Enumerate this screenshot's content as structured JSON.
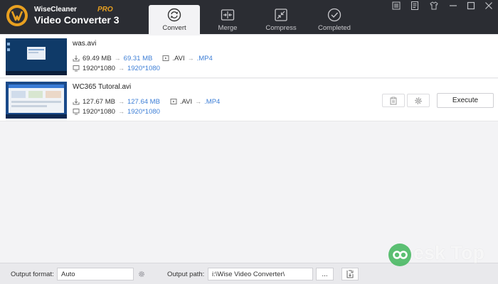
{
  "app": {
    "brand_top": "WiseCleaner",
    "brand_pro": "PRO",
    "brand_name": "Video Converter 3"
  },
  "tabs": [
    {
      "label": "Convert",
      "icon": "convert-icon",
      "active": true
    },
    {
      "label": "Merge",
      "icon": "merge-icon",
      "active": false
    },
    {
      "label": "Compress",
      "icon": "compress-icon",
      "active": false
    },
    {
      "label": "Completed",
      "icon": "completed-icon",
      "active": false
    }
  ],
  "window_controls": [
    "menu-icon",
    "feedback-icon",
    "skin-icon",
    "minimize-icon",
    "maximize-icon",
    "close-icon"
  ],
  "files": [
    {
      "name": "was.avi",
      "size_old": "69.49 MB",
      "size_new": "69.31 MB",
      "format_old": ".AVI",
      "format_new": ".MP4",
      "res_old": "1920*1080",
      "res_new": "1920*1080"
    },
    {
      "name": "WC365 Tutoral.avi",
      "size_old": "127.67 MB",
      "size_new": "127.64 MB",
      "format_old": ".AVI",
      "format_new": ".MP4",
      "res_old": "1920*1080",
      "res_new": "1920*1080",
      "execute_label": "Execute"
    }
  ],
  "arrow": "→",
  "footer": {
    "output_format_label": "Output format:",
    "output_format_value": "Auto",
    "output_path_label": "Output path:",
    "output_path_value": "i:\\Wise Video Converter\\",
    "browse_label": "..."
  },
  "watermark": {
    "text": "esk Top"
  },
  "colors": {
    "header_bg": "#2b2d33",
    "accent_blue": "#3e7fd6",
    "logo_orange": "#e8a020"
  }
}
